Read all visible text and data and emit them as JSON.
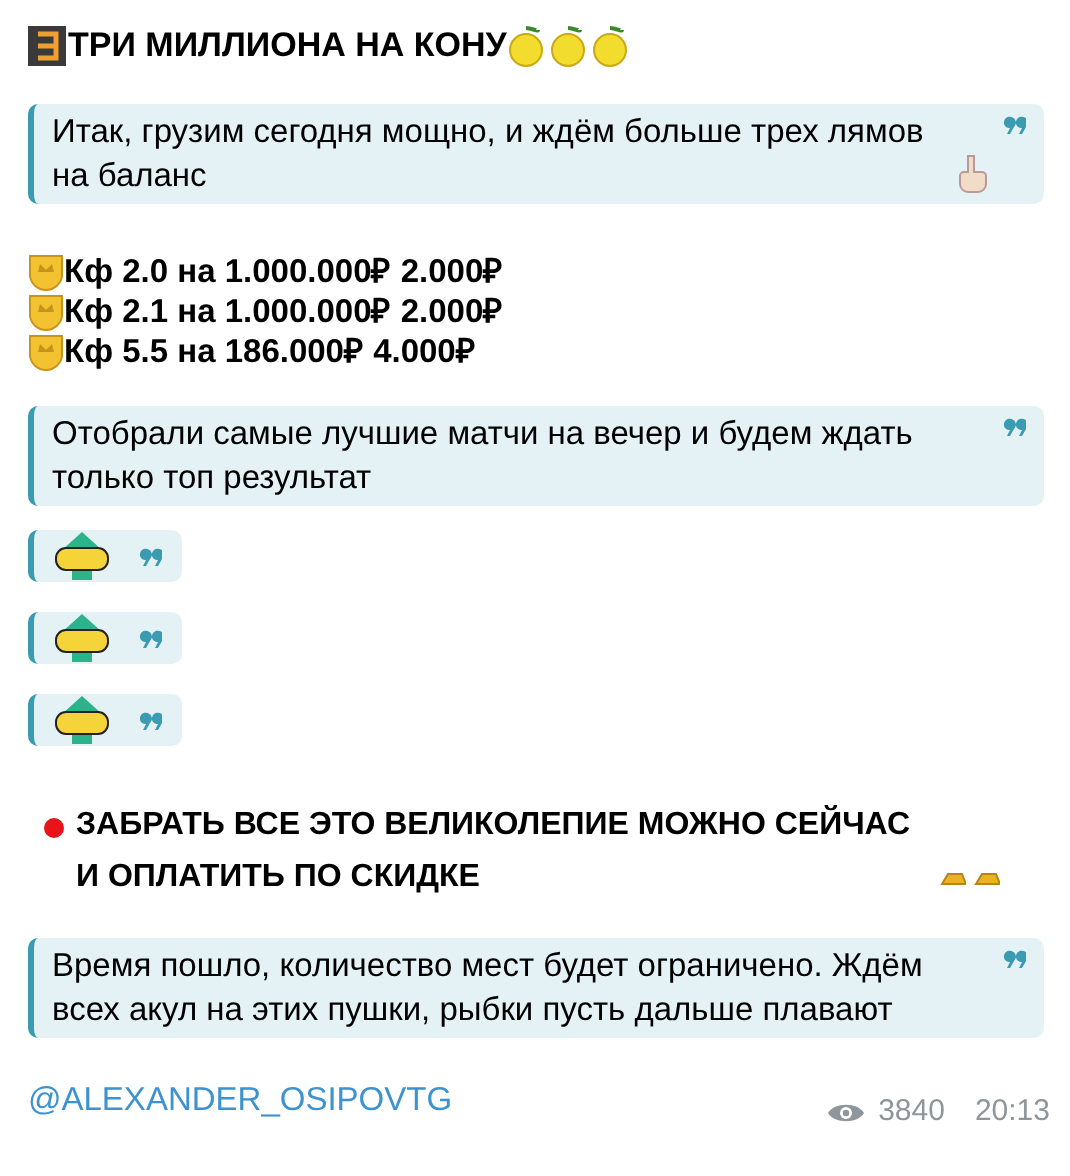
{
  "message": {
    "blocks": [
      {
        "kind": "heading",
        "text": "ТРИ МИЛЛИОНА НА КОНУ"
      },
      {
        "kind": "quote_pointing",
        "text": "Итак, грузим сегодня мощно, и ждём больше трех лямов на баланс"
      },
      {
        "kind": "bets",
        "lines": [
          "Кф 2.0 на 1.000.000₽  2.000₽",
          "Кф 2.1 на 1.000.000₽ 2.000₽",
          "Кф 5.5 на 186.000₽ 4.000₽"
        ]
      },
      {
        "kind": "quote",
        "text": "Отобрали самые лучшие матчи на вечер и будем ждать только топ результат"
      },
      {
        "kind": "top_quote"
      },
      {
        "kind": "top_quote"
      },
      {
        "kind": "top_quote"
      },
      {
        "kind": "alert",
        "text": "ЗАБРАТЬ ВСЕ ЭТО ВЕЛИКОЛЕПИЕ МОЖНО СЕЙЧАС И ОПЛАТИТЬ ПО СКИДКЕ"
      },
      {
        "kind": "quote",
        "text": "Время пошло, количество мест будет ограничено. Ждём всех акул на этих пушки, рыбки пусть дальше плавают"
      },
      {
        "kind": "link",
        "text": "@ALEXANDER_OSIPOVTG"
      }
    ],
    "views": "3840",
    "time": "20:13"
  }
}
